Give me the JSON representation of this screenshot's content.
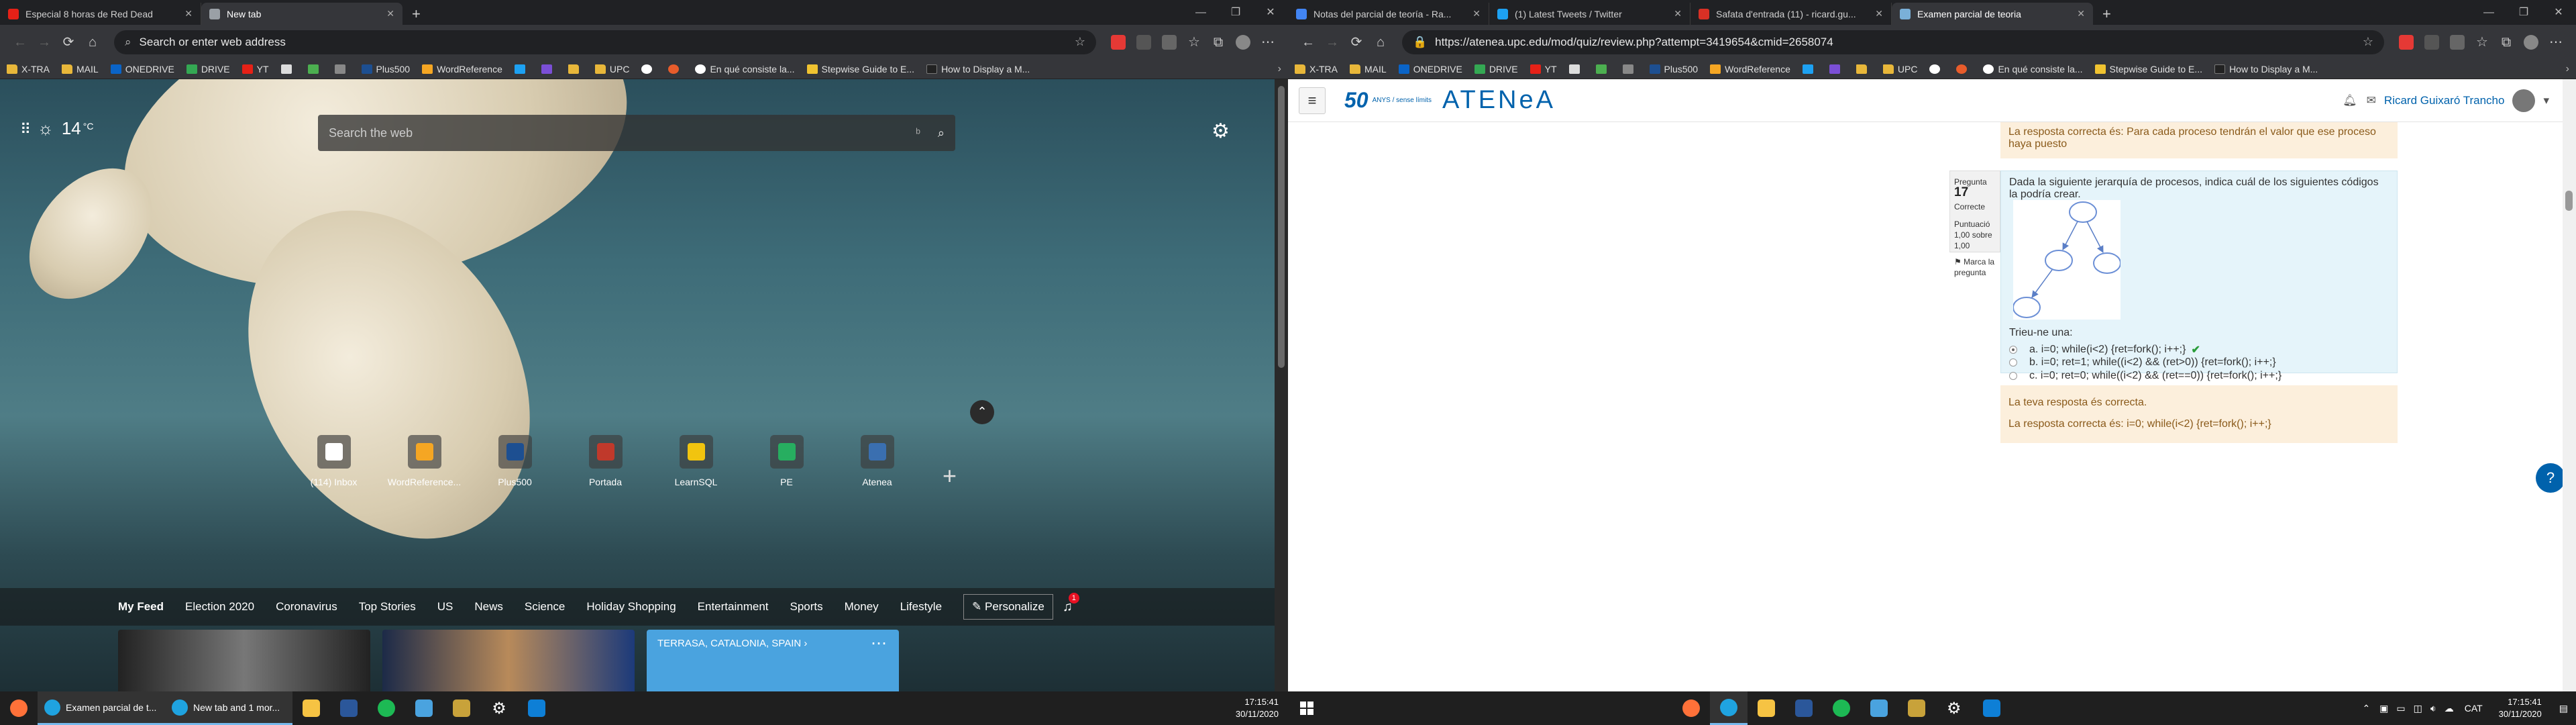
{
  "left": {
    "tabs": [
      {
        "title": "Especial 8 horas de Red Dead",
        "color": "#e62117"
      },
      {
        "title": "New tab",
        "color": "#9aa0a6"
      }
    ],
    "address_placeholder": "Search or enter web address",
    "bookmarks": [
      "X-TRA",
      "MAIL",
      "ONEDRIVE",
      "DRIVE",
      "YT",
      "",
      "",
      "",
      "Plus500",
      "WordReference",
      "",
      "",
      "",
      "UPC",
      "",
      "",
      "En qué consiste la...",
      "Stepwise Guide to E...",
      "How to Display a M..."
    ],
    "weather": {
      "temp": "14",
      "unit": "°C"
    },
    "search_placeholder": "Search the web",
    "quick_links": [
      {
        "label": "(114) Inbox",
        "color": "#ffffff"
      },
      {
        "label": "WordReference...",
        "color": "#f5a623"
      },
      {
        "label": "Plus500",
        "color": "#1d4f91"
      },
      {
        "label": "Portada",
        "color": "#c0392b"
      },
      {
        "label": "LearnSQL",
        "color": "#f1c40f"
      },
      {
        "label": "PE",
        "color": "#27ae60"
      },
      {
        "label": "Atenea",
        "color": "#3a6fb0"
      }
    ],
    "feed_tabs": [
      "My Feed",
      "Election 2020",
      "Coronavirus",
      "Top Stories",
      "US",
      "News",
      "Science",
      "Holiday Shopping",
      "Entertainment",
      "Sports",
      "Money",
      "Lifestyle"
    ],
    "personalize": "Personalize",
    "notif_count": "1",
    "weather_card": "TERRASA, CATALONIA, SPAIN",
    "taskbar_apps": [
      "Examen parcial de t...",
      "New tab and 1 mor..."
    ],
    "clock_time": "17:15:41",
    "clock_date": "30/11/2020"
  },
  "right": {
    "tabs": [
      {
        "title": "Notas del parcial de teoría - Ra...",
        "color": "#4285f4"
      },
      {
        "title": "(1) Latest Tweets / Twitter",
        "color": "#1da1f2"
      },
      {
        "title": "Safata d'entrada (11) - ricard.gu...",
        "color": "#d93025"
      },
      {
        "title": "Examen parcial de teoria",
        "color": "#7ab0d8"
      }
    ],
    "url": "https://atenea.upc.edu/mod/quiz/review.php?attempt=3419654&cmid=2658074",
    "logo_50": "50",
    "logo_small": "ANYS / sense límits",
    "logo_atenea": "ATENeA",
    "user_name": "Ricard Guixaró Trancho",
    "feedback_top": "La resposta correcta és: Para cada proceso tendrán el valor que ese proceso haya puesto",
    "question": {
      "label": "Pregunta",
      "number": "17",
      "state": "Correcte",
      "score": "Puntuació 1,00 sobre 1,00",
      "flag": "Marca la pregunta",
      "text": "Dada la siguiente jerarquía de procesos, indica cuál de los siguientes códigos la podría crear.",
      "choose": "Trieu-ne una:",
      "options": [
        "a. i=0; while(i<2) {ret=fork(); i++;}",
        "b. i=0; ret=1; while((i<2) && (ret>0)) {ret=fork(); i++;}",
        "c. i=0; ret=0; while((i<2) && (ret==0)) {ret=fork(); i++;}"
      ],
      "feedback_1": "La teva resposta és correcta.",
      "feedback_2": "La resposta correcta és: i=0; while(i<2) {ret=fork(); i++;}"
    },
    "tray_lang": "CAT",
    "clock_time": "17:15:41",
    "clock_date": "30/11/2020"
  },
  "icons": {
    "back": "←",
    "forward": "→",
    "reload": "⟳",
    "home": "⌂",
    "star": "☆",
    "search": "⌕",
    "gear": "⚙",
    "plus": "+",
    "chevron_up": "⌃",
    "bell": "🔔",
    "check": "✔",
    "help": "?"
  }
}
